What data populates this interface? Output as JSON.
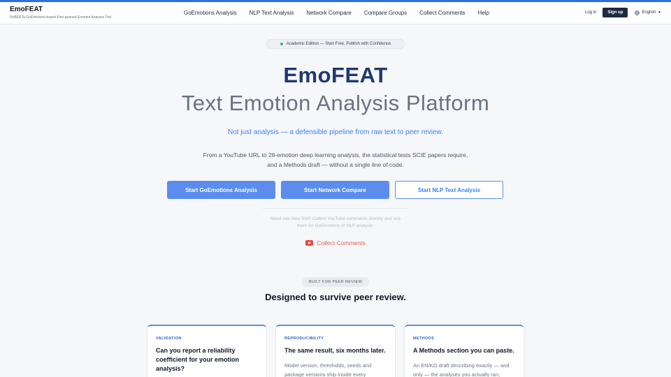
{
  "brand": {
    "name": "EmoFEAT",
    "subtitle": "RoBERTa GoEmotions-based Fine-grained Emotion Analysis Tool"
  },
  "nav": {
    "items": [
      {
        "label": "GoEmotions Analysis"
      },
      {
        "label": "NLP Text Analysis"
      },
      {
        "label": "Network Compare"
      },
      {
        "label": "Compare Groups"
      },
      {
        "label": "Collect Comments"
      },
      {
        "label": "Help"
      }
    ]
  },
  "auth": {
    "login": "Log in",
    "signup": "Sign up",
    "language": "English"
  },
  "hero": {
    "badge": "Academic Edition — Start Free, Publish with Confidence",
    "logo": "EmoFEAT",
    "title": "Text Emotion Analysis Platform",
    "tagline": "Not just analysis — a defensible pipeline from raw text to peer review.",
    "description_line1": "From a YouTube URL to 28-emotion deep learning analysis, the statistical tests SCIE papers require,",
    "description_line2": "and a Methods draft — without a single line of code.",
    "buttons": {
      "goemotions": "Start GoEmotions Analysis",
      "network": "Start Network Compare",
      "nlp": "Start NLP Text Analysis"
    },
    "hint_line1": "Need raw data first? Collect YouTube comments directly and use",
    "hint_line2": "them for GoEmotions or NLP analysis.",
    "collect_link": "Collect Comments"
  },
  "section": {
    "badge": "BUILT FOR PEER REVIEW",
    "title": "Designed to survive peer review."
  },
  "cards": [
    {
      "label": "VALIDATION",
      "title": "Can you report a reliability coefficient for your emotion analysis?",
      "body": ""
    },
    {
      "label": "REPRODUCIBILITY",
      "title": "The same result, six months later.",
      "body": "Model version, thresholds, seeds and package versions ship inside every"
    },
    {
      "label": "METHODS",
      "title": "A Methods section you can paste.",
      "body": "An EN/KO draft describing exactly — and only — the analyses you actually ran,"
    }
  ],
  "colors": {
    "accent": "#2f6fe0",
    "primary_button": "#5b8def",
    "logo": "#1e3a6e",
    "youtube": "#ef4444"
  },
  "icons": {
    "language": "globe-icon",
    "collect": "youtube-icon",
    "status": "dot-icon"
  }
}
